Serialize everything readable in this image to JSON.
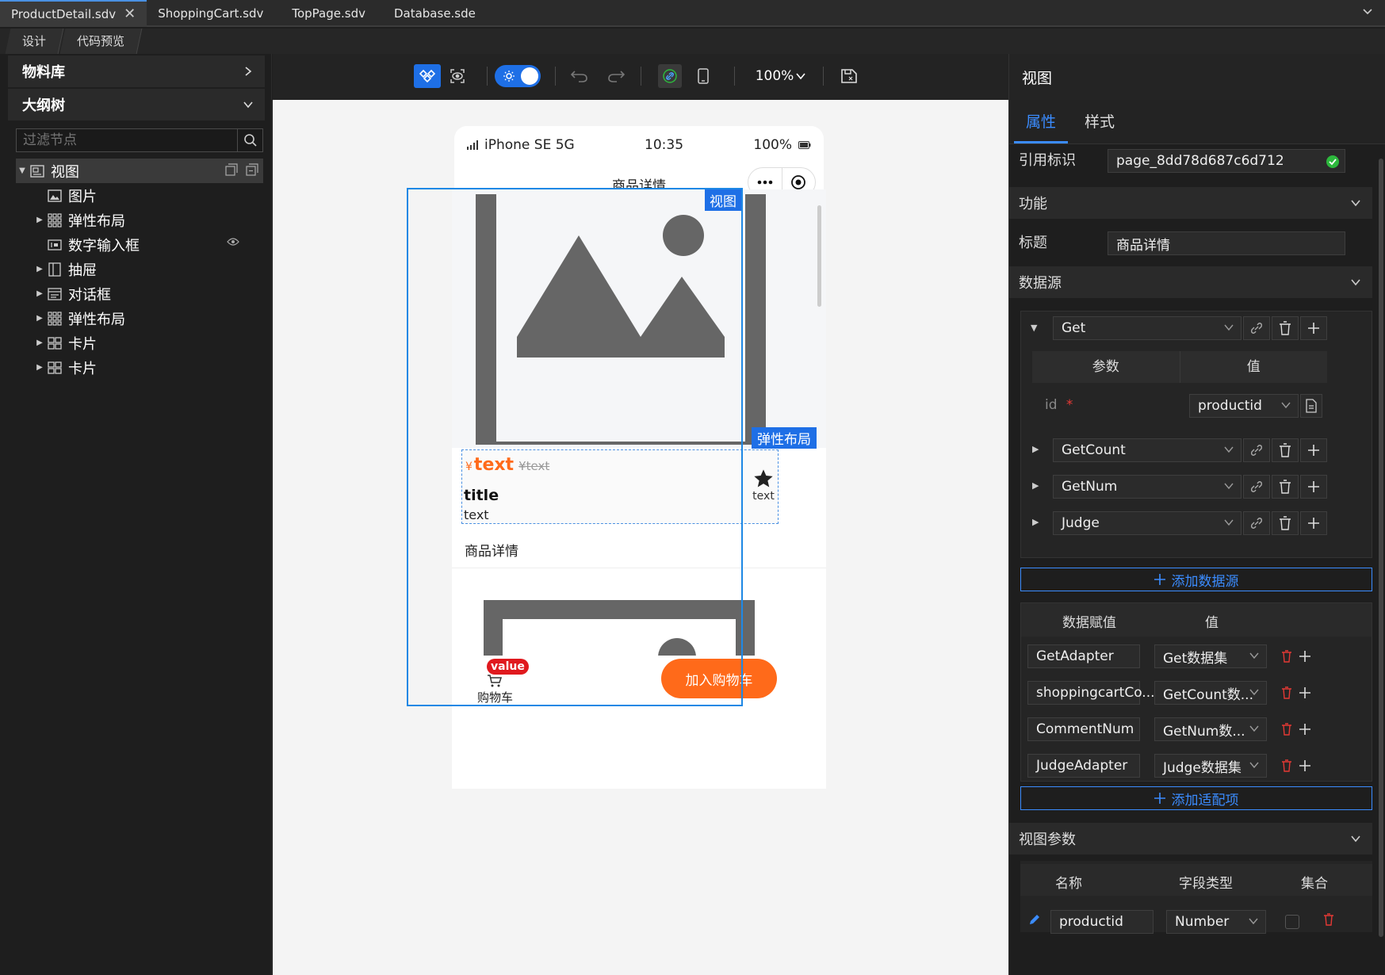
{
  "file_tabs": [
    {
      "label": "ProductDetail.sdv",
      "active": true
    },
    {
      "label": "ShoppingCart.sdv"
    },
    {
      "label": "TopPage.sdv"
    },
    {
      "label": "Database.sde"
    }
  ],
  "sub_tabs": [
    "设计",
    "代码预览"
  ],
  "left": {
    "materials_label": "物料库",
    "outline_label": "大纲树",
    "filter_placeholder": "过滤节点",
    "tree": [
      {
        "label": "视图",
        "icon": "view-icon",
        "expand": "open"
      },
      {
        "label": "图片",
        "icon": "image-icon"
      },
      {
        "label": "弹性布局",
        "icon": "grid-icon",
        "expand": "closed"
      },
      {
        "label": "数字输入框",
        "icon": "number-input-icon"
      },
      {
        "label": "抽屉",
        "icon": "drawer-icon",
        "expand": "closed"
      },
      {
        "label": "对话框",
        "icon": "dialog-icon",
        "expand": "closed"
      },
      {
        "label": "弹性布局",
        "icon": "grid-icon",
        "expand": "closed"
      },
      {
        "label": "卡片",
        "icon": "card-icon",
        "expand": "closed"
      },
      {
        "label": "卡片",
        "icon": "card-icon",
        "expand": "closed"
      }
    ]
  },
  "toolbar": {
    "zoom": "100%"
  },
  "phone": {
    "carrier": "iPhone SE 5G",
    "time": "10:35",
    "battery": "100%",
    "nav_title": "商品详情",
    "view_tag": "视图",
    "flex_tag": "弹性布局",
    "price_symbol": "¥",
    "price": "text",
    "old_price": "¥text",
    "title": "title",
    "subtitle": "text",
    "star_text": "text",
    "section_title": "商品详情",
    "cart_badge": "value",
    "cart_label": "购物车",
    "add_cart_label": "加入购物车"
  },
  "panel": {
    "title": "视图",
    "tabs": [
      "属性",
      "样式"
    ],
    "ref_label": "引用标识",
    "ref_value": "page_8dd78d687c6d712",
    "function_label": "功能",
    "title_label": "标题",
    "title_value": "商品详情",
    "datasource_label": "数据源",
    "datasources": [
      "Get",
      "GetCount",
      "GetNum",
      "Judge"
    ],
    "param_header": "参数",
    "value_header": "值",
    "param_name": "id",
    "param_required": "*",
    "param_value": "productid",
    "add_datasource": "添加数据源",
    "assign_header": "数据赋值",
    "assign_value_header": "值",
    "assigns": [
      {
        "name": "GetAdapter",
        "value": "Get数据集"
      },
      {
        "name": "shoppingcartCo...",
        "value": "GetCount数..."
      },
      {
        "name": "CommentNum",
        "value": "GetNum数..."
      },
      {
        "name": "JudgeAdapter",
        "value": "Judge数据集"
      }
    ],
    "add_adapter": "添加适配项",
    "view_params_label": "视图参数",
    "vp_headers": [
      "名称",
      "字段类型",
      "集合"
    ],
    "vp_name": "productid",
    "vp_type": "Number"
  },
  "colors": {
    "accent": "#3b8cff",
    "orange": "#ff6a1a",
    "red": "#e53935",
    "green": "#2db83d"
  }
}
